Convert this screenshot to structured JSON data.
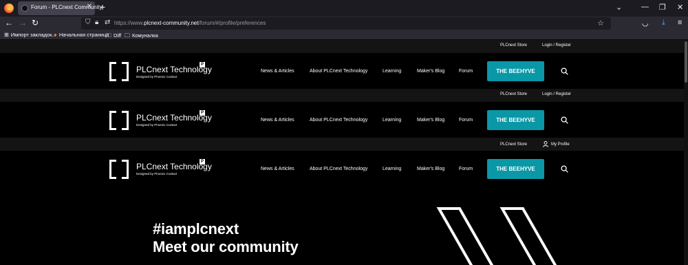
{
  "browser": {
    "tab_title": "Forum - PLCnext Community",
    "url_prefix": "https://www.",
    "url_domain": "plcnext-community.net",
    "url_path": "/forum/#/profile/preferences",
    "bookmarks": [
      "Импорт закладок...",
      "Начальная страница",
      "Diff",
      "Комуналка"
    ]
  },
  "site": {
    "store_link": "PLCnext Store",
    "login_link": "Login / Register",
    "profile_link": "My Profile",
    "logo_title": "PLCnext Technology",
    "logo_subtitle": "Designed by Phoenix Contact",
    "logo_badge": "P",
    "menu": [
      "News & Articles",
      "About PLCnext Technology",
      "Learning",
      "Maker's Blog",
      "Forum"
    ],
    "cta_label": "THE BEEHYVE",
    "accent_color": "#0a98a7"
  },
  "hero": {
    "line1": "#iamplcnext",
    "line2": "Meet our community"
  }
}
